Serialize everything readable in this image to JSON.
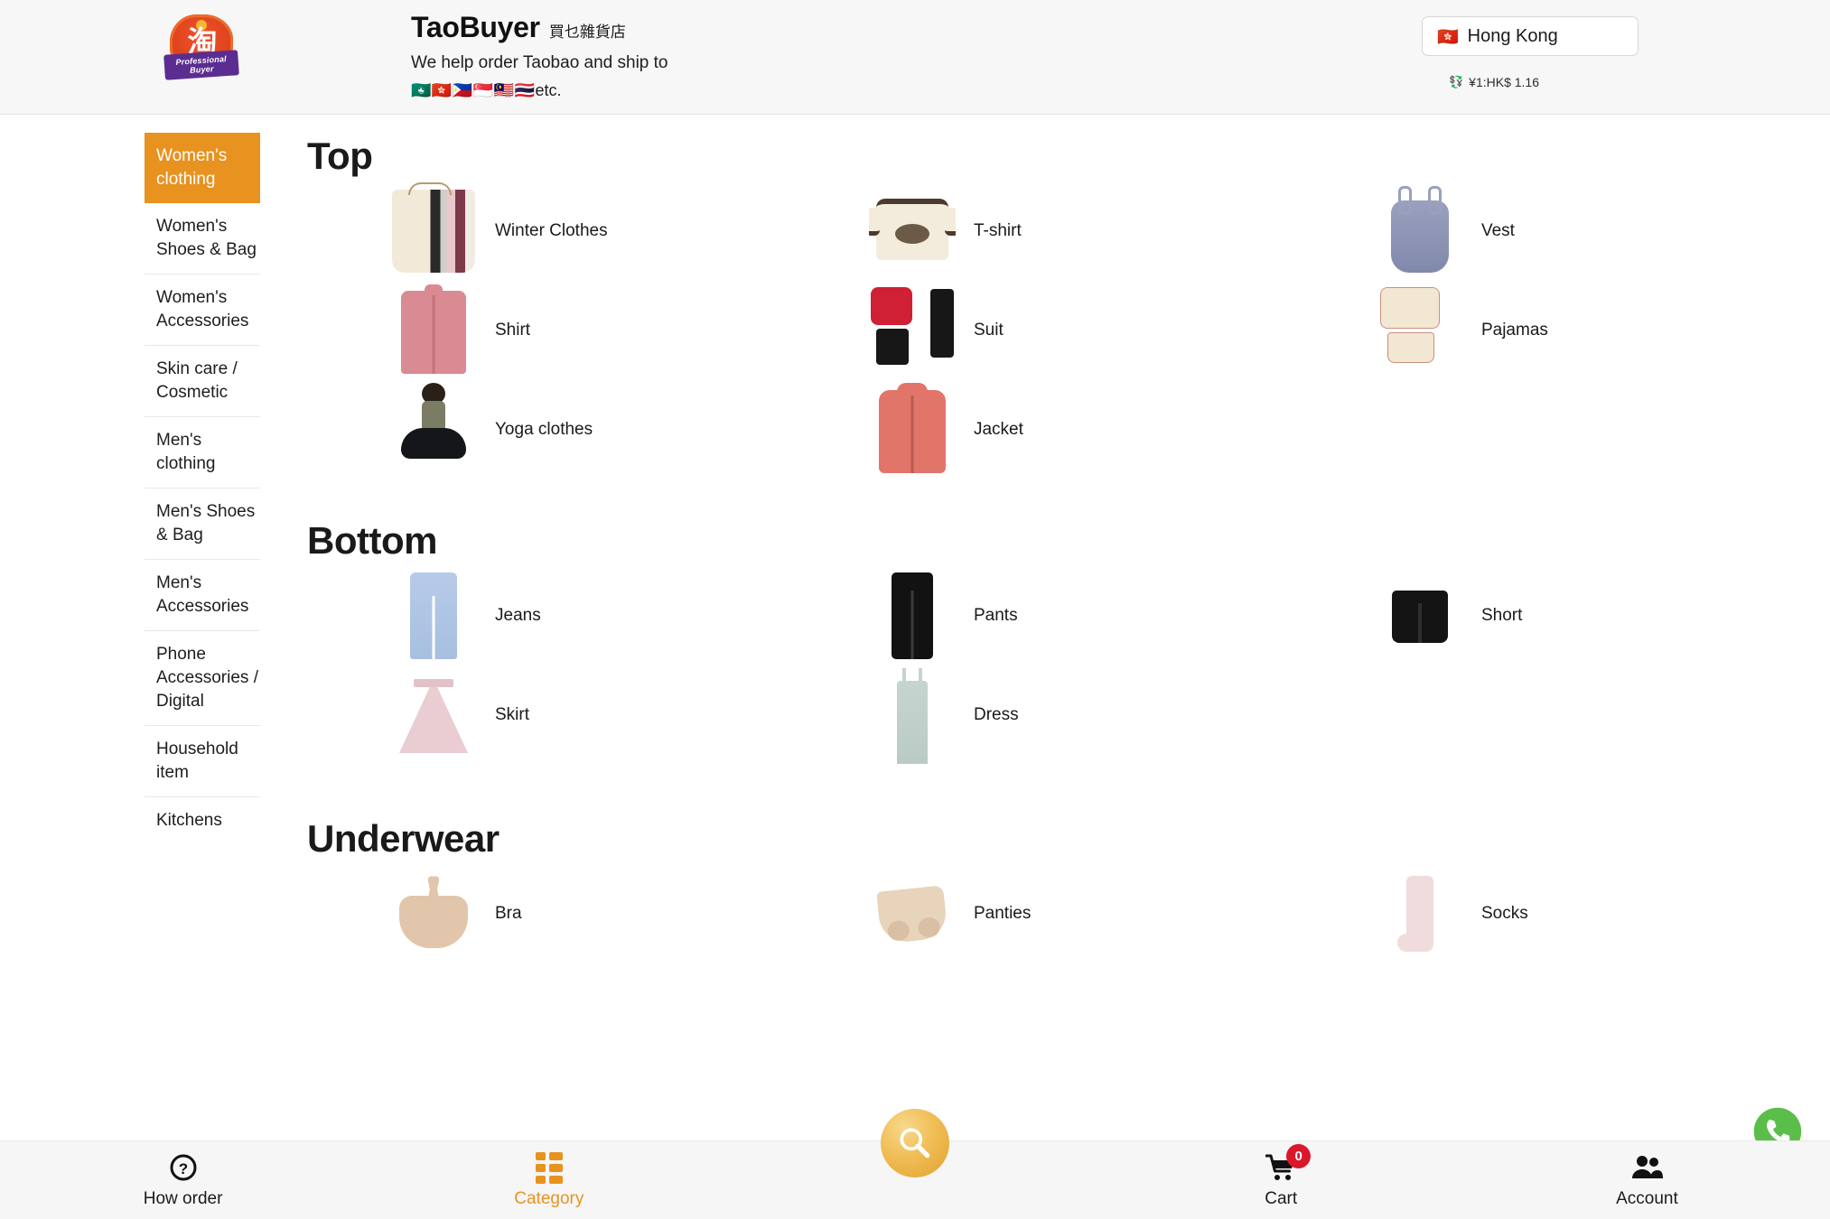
{
  "header": {
    "logo_char": "淘",
    "logo_ribbon_line1": "Professional",
    "logo_ribbon_line2": "Buyer",
    "brand_name": "TaoBuyer",
    "brand_name_cn": "買乜雜貨店",
    "tagline": "We help order Taobao and ship to",
    "flags": "🇲🇴🇭🇰🇵🇭🇸🇬🇲🇾🇹🇭",
    "flags_suffix": "etc.",
    "country_flag": "🇭🇰",
    "country_label": "Hong Kong",
    "rate_icon": "💱",
    "rate_text": "¥1:HK$ 1.16"
  },
  "sidebar": {
    "items": [
      {
        "label": "Women's clothing",
        "active": true
      },
      {
        "label": "Women's Shoes & Bag",
        "active": false
      },
      {
        "label": "Women's Accessories",
        "active": false
      },
      {
        "label": "Skin care / Cosmetic",
        "active": false
      },
      {
        "label": "Men's clothing",
        "active": false
      },
      {
        "label": "Men's Shoes & Bag",
        "active": false
      },
      {
        "label": "Men's Accessories",
        "active": false
      },
      {
        "label": "Phone Accessories / Digital",
        "active": false
      },
      {
        "label": "Household item",
        "active": false
      },
      {
        "label": "Kitchens",
        "active": false
      }
    ]
  },
  "sections": [
    {
      "title": "Top",
      "items": [
        {
          "label": "Winter Clothes",
          "art": "rack"
        },
        {
          "label": "T-shirt",
          "art": "tee"
        },
        {
          "label": "Vest",
          "art": "vest"
        },
        {
          "label": "Shirt",
          "art": "shirt"
        },
        {
          "label": "Suit",
          "art": "suit"
        },
        {
          "label": "Pajamas",
          "art": "pajamas"
        },
        {
          "label": "Yoga clothes",
          "art": "yoga"
        },
        {
          "label": "Jacket",
          "art": "jacket"
        }
      ]
    },
    {
      "title": "Bottom",
      "items": [
        {
          "label": "Jeans",
          "art": "jeans"
        },
        {
          "label": "Pants",
          "art": "pants"
        },
        {
          "label": "Short",
          "art": "short"
        },
        {
          "label": "Skirt",
          "art": "skirt"
        },
        {
          "label": "Dress",
          "art": "dress"
        }
      ]
    },
    {
      "title": "Underwear",
      "items": [
        {
          "label": "Bra",
          "art": "bra"
        },
        {
          "label": "Panties",
          "art": "panty"
        },
        {
          "label": "Socks",
          "art": "sock"
        }
      ]
    }
  ],
  "bottom_nav": {
    "items": [
      {
        "label": "How order",
        "icon": "question-circle-icon",
        "active": false
      },
      {
        "label": "Category",
        "icon": "grid-icon",
        "active": true
      },
      {
        "label": "Cart",
        "icon": "cart-icon",
        "active": false,
        "badge": "0"
      },
      {
        "label": "Account",
        "icon": "users-icon",
        "active": false
      }
    ],
    "search_icon": "magnifier-icon"
  },
  "floating": {
    "whatsapp_icon": "whatsapp-icon"
  },
  "colors": {
    "accent": "#e8921f",
    "badge": "#d9182b",
    "whatsapp": "#5cbe4a"
  }
}
